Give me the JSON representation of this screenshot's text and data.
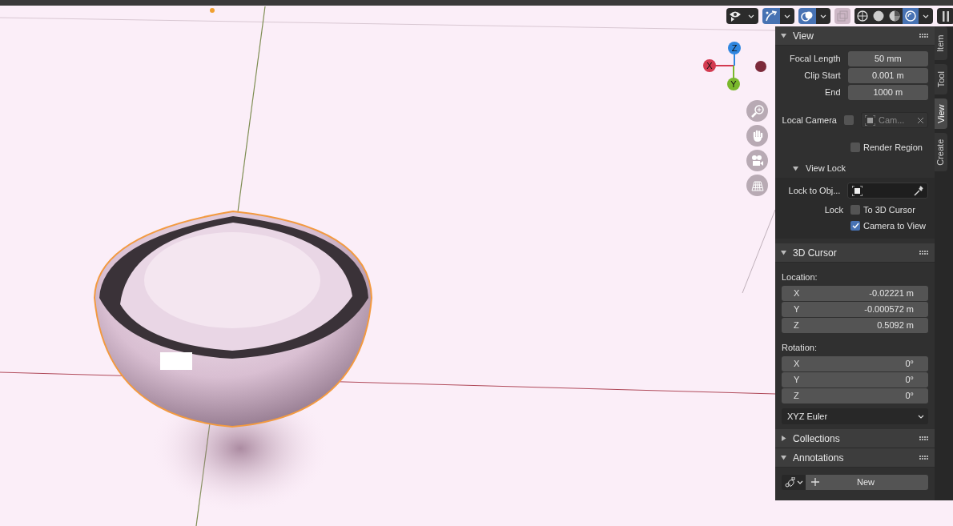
{
  "header_tools": [
    {
      "kind": "visibility",
      "selected": false
    },
    {
      "kind": "gizmos",
      "selected": true
    },
    {
      "kind": "overlays",
      "selected": true
    },
    {
      "kind": "xray",
      "selected": false
    }
  ],
  "shading_modes": [
    {
      "kind": "wireframe",
      "selected": false
    },
    {
      "kind": "solid",
      "selected": false
    },
    {
      "kind": "material",
      "selected": false
    },
    {
      "kind": "rendered",
      "selected": true
    }
  ],
  "gizmo": {
    "x": "X",
    "y": "Y",
    "z": "Z"
  },
  "sidebar_tabs": [
    {
      "label": "Item",
      "selected": false
    },
    {
      "label": "Tool",
      "selected": false
    },
    {
      "label": "View",
      "selected": true
    },
    {
      "label": "Create",
      "selected": false
    }
  ],
  "panels": [
    {
      "title": "View",
      "expanded": true,
      "rows": [
        {
          "kind": "number",
          "label": "Focal Length",
          "value": "50 mm"
        },
        {
          "kind": "number",
          "label": "Clip Start",
          "value": "0.001 m"
        },
        {
          "kind": "number",
          "label": "End",
          "value": "1000 m"
        },
        {
          "kind": "camera",
          "label": "Local Camera",
          "checked": false,
          "disabled": true,
          "value": "Cam..."
        },
        {
          "kind": "checkbox",
          "label": "Render Region",
          "checked": false
        },
        {
          "kind": "subpanel",
          "label": "View Lock",
          "expanded": true
        },
        {
          "kind": "lock_object",
          "label": "Lock to Obj..."
        },
        {
          "kind": "lock",
          "label": "Lock",
          "option": "To 3D Cursor",
          "checked": false
        },
        {
          "kind": "checkbox",
          "label": "Camera to View",
          "checked": true
        }
      ]
    },
    {
      "title": "3D Cursor",
      "expanded": true,
      "rows": [
        {
          "kind": "heading",
          "label": "Location:"
        },
        {
          "kind": "vector",
          "items": [
            {
              "axis": "X",
              "value": "-0.02221 m"
            },
            {
              "axis": "Y",
              "value": "-0.000572 m"
            },
            {
              "axis": "Z",
              "value": "0.5092 m"
            }
          ]
        },
        {
          "kind": "heading",
          "label": "Rotation:"
        },
        {
          "kind": "vector",
          "items": [
            {
              "axis": "X",
              "value": "0°"
            },
            {
              "axis": "Y",
              "value": "0°"
            },
            {
              "axis": "Z",
              "value": "0°"
            }
          ]
        },
        {
          "kind": "dropdown",
          "value": "XYZ Euler"
        }
      ]
    },
    {
      "title": "Collections",
      "expanded": false
    },
    {
      "title": "Annotations",
      "expanded": true,
      "rows": [
        {
          "kind": "new",
          "label": "New"
        }
      ]
    }
  ]
}
